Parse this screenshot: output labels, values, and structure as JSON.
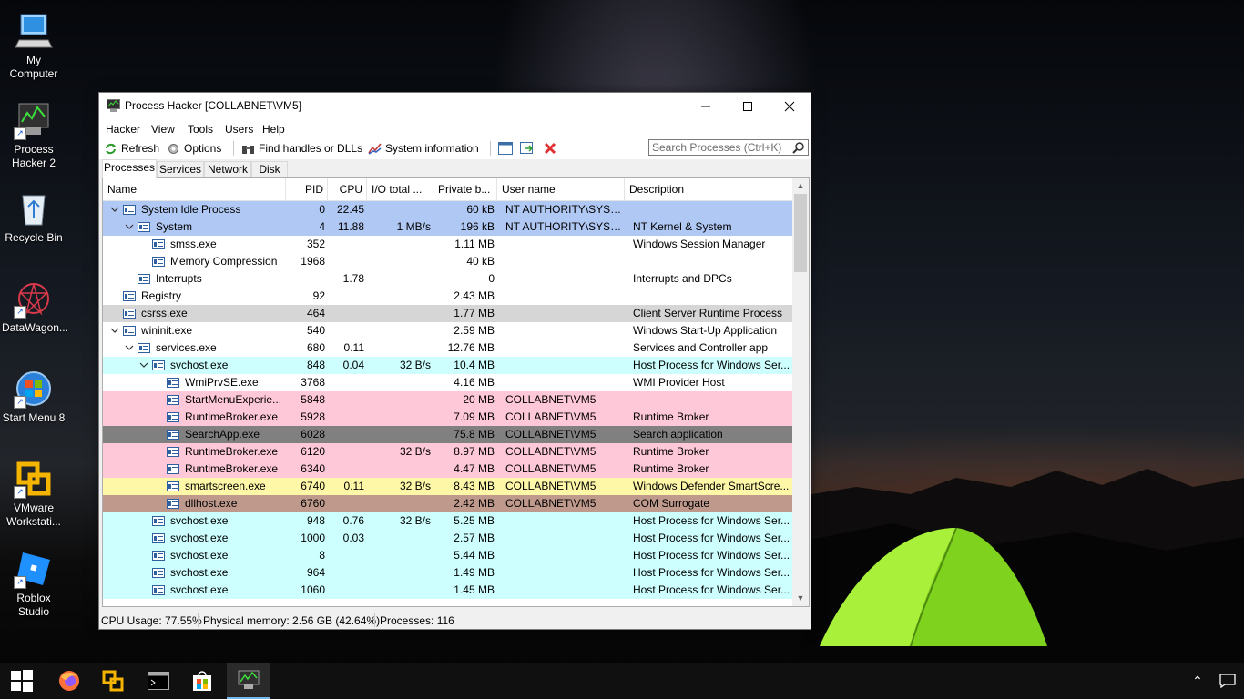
{
  "desktop": {
    "icons": [
      {
        "label": "My Computer",
        "icon": "computer-icon"
      },
      {
        "label": "Process Hacker 2",
        "icon": "process-hacker-icon"
      },
      {
        "label": "Recycle Bin",
        "icon": "recycle-bin-icon"
      },
      {
        "label": "DataWagon...",
        "icon": "datawagon-icon"
      },
      {
        "label": "Start Menu 8",
        "icon": "start-menu-8-icon"
      },
      {
        "label": "VMware Workstati...",
        "icon": "vmware-icon"
      },
      {
        "label": "Roblox Studio",
        "icon": "roblox-studio-icon"
      }
    ]
  },
  "window": {
    "title": "Process Hacker [COLLABNET\\VM5]",
    "menu": [
      "Hacker",
      "View",
      "Tools",
      "Users",
      "Help"
    ],
    "toolbar": {
      "refresh": "Refresh",
      "options": "Options",
      "find_handles": "Find handles or DLLs",
      "system_info": "System information"
    },
    "search_placeholder": "Search Processes (Ctrl+K)",
    "tabs": [
      "Processes",
      "Services",
      "Network",
      "Disk"
    ],
    "active_tab": "Processes",
    "columns": [
      "Name",
      "PID",
      "CPU",
      "I/O total ...",
      "Private b...",
      "User name",
      "Description"
    ],
    "processes": [
      {
        "name": "System Idle Process",
        "pid": "0",
        "cpu": "22.45",
        "io": "",
        "private": "60 kB",
        "user": "NT AUTHORITY\\SYSTEM",
        "desc": "",
        "bg": "#b0c8f4",
        "exp": "v"
      },
      {
        "name": "System",
        "pid": "4",
        "cpu": "11.88",
        "io": "1 MB/s",
        "private": "196 kB",
        "user": "NT AUTHORITY\\SYSTEM",
        "desc": "NT Kernel & System",
        "bg": "#b0c8f4",
        "exp": "v"
      },
      {
        "name": "smss.exe",
        "pid": "352",
        "cpu": "",
        "io": "",
        "private": "1.11 MB",
        "user": "",
        "desc": "Windows Session Manager",
        "bg": "#ffffff",
        "exp": ""
      },
      {
        "name": "Memory Compression",
        "pid": "1968",
        "cpu": "",
        "io": "",
        "private": "40 kB",
        "user": "",
        "desc": "",
        "bg": "#ffffff",
        "exp": ""
      },
      {
        "name": "Interrupts",
        "pid": "",
        "cpu": "1.78",
        "io": "",
        "private": "0",
        "user": "",
        "desc": "Interrupts and DPCs",
        "bg": "#ffffff",
        "exp": ""
      },
      {
        "name": "Registry",
        "pid": "92",
        "cpu": "",
        "io": "",
        "private": "2.43 MB",
        "user": "",
        "desc": "",
        "bg": "#ffffff",
        "exp": ""
      },
      {
        "name": "csrss.exe",
        "pid": "464",
        "cpu": "",
        "io": "",
        "private": "1.77 MB",
        "user": "",
        "desc": "Client Server Runtime Process",
        "bg": "#d6d6d6",
        "exp": ""
      },
      {
        "name": "wininit.exe",
        "pid": "540",
        "cpu": "",
        "io": "",
        "private": "2.59 MB",
        "user": "",
        "desc": "Windows Start-Up Application",
        "bg": "#ffffff",
        "exp": "v"
      },
      {
        "name": "services.exe",
        "pid": "680",
        "cpu": "0.11",
        "io": "",
        "private": "12.76 MB",
        "user": "",
        "desc": "Services and Controller app",
        "bg": "#ffffff",
        "exp": "v"
      },
      {
        "name": "svchost.exe",
        "pid": "848",
        "cpu": "0.04",
        "io": "32 B/s",
        "private": "10.4 MB",
        "user": "",
        "desc": "Host Process for Windows Ser...",
        "bg": "#cdffff",
        "exp": "v"
      },
      {
        "name": "WmiPrvSE.exe",
        "pid": "3768",
        "cpu": "",
        "io": "",
        "private": "4.16 MB",
        "user": "",
        "desc": "WMI Provider Host",
        "bg": "#ffffff",
        "exp": ""
      },
      {
        "name": "StartMenuExperie...",
        "pid": "5848",
        "cpu": "",
        "io": "",
        "private": "20 MB",
        "user": "COLLABNET\\VM5",
        "desc": "",
        "bg": "#ffc8d8",
        "exp": ""
      },
      {
        "name": "RuntimeBroker.exe",
        "pid": "5928",
        "cpu": "",
        "io": "",
        "private": "7.09 MB",
        "user": "COLLABNET\\VM5",
        "desc": "Runtime Broker",
        "bg": "#ffc8d8",
        "exp": ""
      },
      {
        "name": "SearchApp.exe",
        "pid": "6028",
        "cpu": "",
        "io": "",
        "private": "75.8 MB",
        "user": "COLLABNET\\VM5",
        "desc": "Search application",
        "bg": "#808080",
        "exp": ""
      },
      {
        "name": "RuntimeBroker.exe",
        "pid": "6120",
        "cpu": "",
        "io": "32 B/s",
        "private": "8.97 MB",
        "user": "COLLABNET\\VM5",
        "desc": "Runtime Broker",
        "bg": "#ffc8d8",
        "exp": ""
      },
      {
        "name": "RuntimeBroker.exe",
        "pid": "6340",
        "cpu": "",
        "io": "",
        "private": "4.47 MB",
        "user": "COLLABNET\\VM5",
        "desc": "Runtime Broker",
        "bg": "#ffc8d8",
        "exp": ""
      },
      {
        "name": "smartscreen.exe",
        "pid": "6740",
        "cpu": "0.11",
        "io": "32 B/s",
        "private": "8.43 MB",
        "user": "COLLABNET\\VM5",
        "desc": "Windows Defender SmartScre...",
        "bg": "#fff7a8",
        "exp": ""
      },
      {
        "name": "dllhost.exe",
        "pid": "6760",
        "cpu": "",
        "io": "",
        "private": "2.42 MB",
        "user": "COLLABNET\\VM5",
        "desc": "COM Surrogate",
        "bg": "#bf9a8c",
        "exp": ""
      },
      {
        "name": "svchost.exe",
        "pid": "948",
        "cpu": "0.76",
        "io": "32 B/s",
        "private": "5.25 MB",
        "user": "",
        "desc": "Host Process for Windows Ser...",
        "bg": "#cdffff",
        "exp": ""
      },
      {
        "name": "svchost.exe",
        "pid": "1000",
        "cpu": "0.03",
        "io": "",
        "private": "2.57 MB",
        "user": "",
        "desc": "Host Process for Windows Ser...",
        "bg": "#cdffff",
        "exp": ""
      },
      {
        "name": "svchost.exe",
        "pid": "8",
        "cpu": "",
        "io": "",
        "private": "5.44 MB",
        "user": "",
        "desc": "Host Process for Windows Ser...",
        "bg": "#cdffff",
        "exp": ""
      },
      {
        "name": "svchost.exe",
        "pid": "964",
        "cpu": "",
        "io": "",
        "private": "1.49 MB",
        "user": "",
        "desc": "Host Process for Windows Ser...",
        "bg": "#cdffff",
        "exp": ""
      },
      {
        "name": "svchost.exe",
        "pid": "1060",
        "cpu": "",
        "io": "",
        "private": "1.45 MB",
        "user": "",
        "desc": "Host Process for Windows Ser...",
        "bg": "#cdffff",
        "exp": ""
      }
    ],
    "status": {
      "cpu": "CPU Usage: 77.55%",
      "memory": "Physical memory: 2.56 GB (42.64%)",
      "processes": "Processes: 116"
    }
  },
  "taskbar": {
    "items": [
      "windows-start-icon",
      "firefox-icon",
      "vmware-icon",
      "terminal-icon",
      "store-icon",
      "process-hacker-icon"
    ]
  }
}
